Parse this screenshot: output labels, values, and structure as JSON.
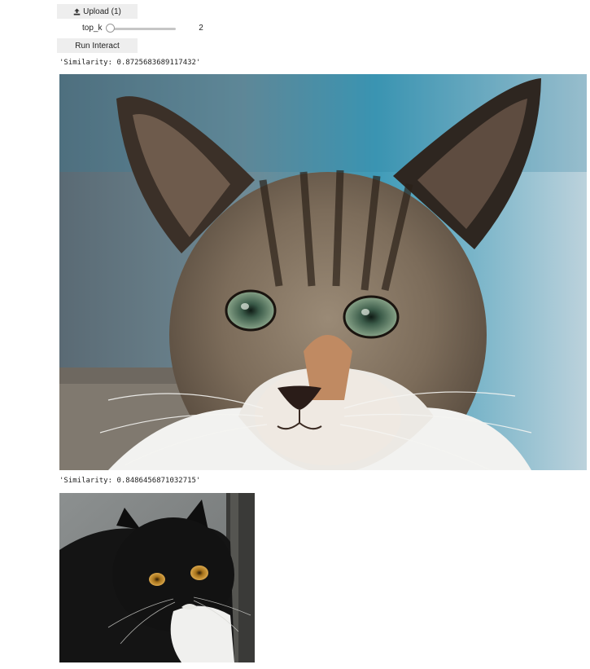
{
  "controls": {
    "upload_label": "Upload (1)",
    "upload_icon": "upload-icon",
    "slider_label": "top_k",
    "slider_value": "2",
    "run_label": "Run Interact"
  },
  "results": [
    {
      "similarity_text": "'Similarity: 0.8725683689117432'",
      "image_desc": "tabby-cat-photo"
    },
    {
      "similarity_text": "'Similarity: 0.8486456871032715'",
      "image_desc": "black-white-cat-photo"
    }
  ],
  "colors": {
    "button_bg": "#eeeeee",
    "slider_track": "#c6c6c6",
    "background": "#ffffff"
  }
}
